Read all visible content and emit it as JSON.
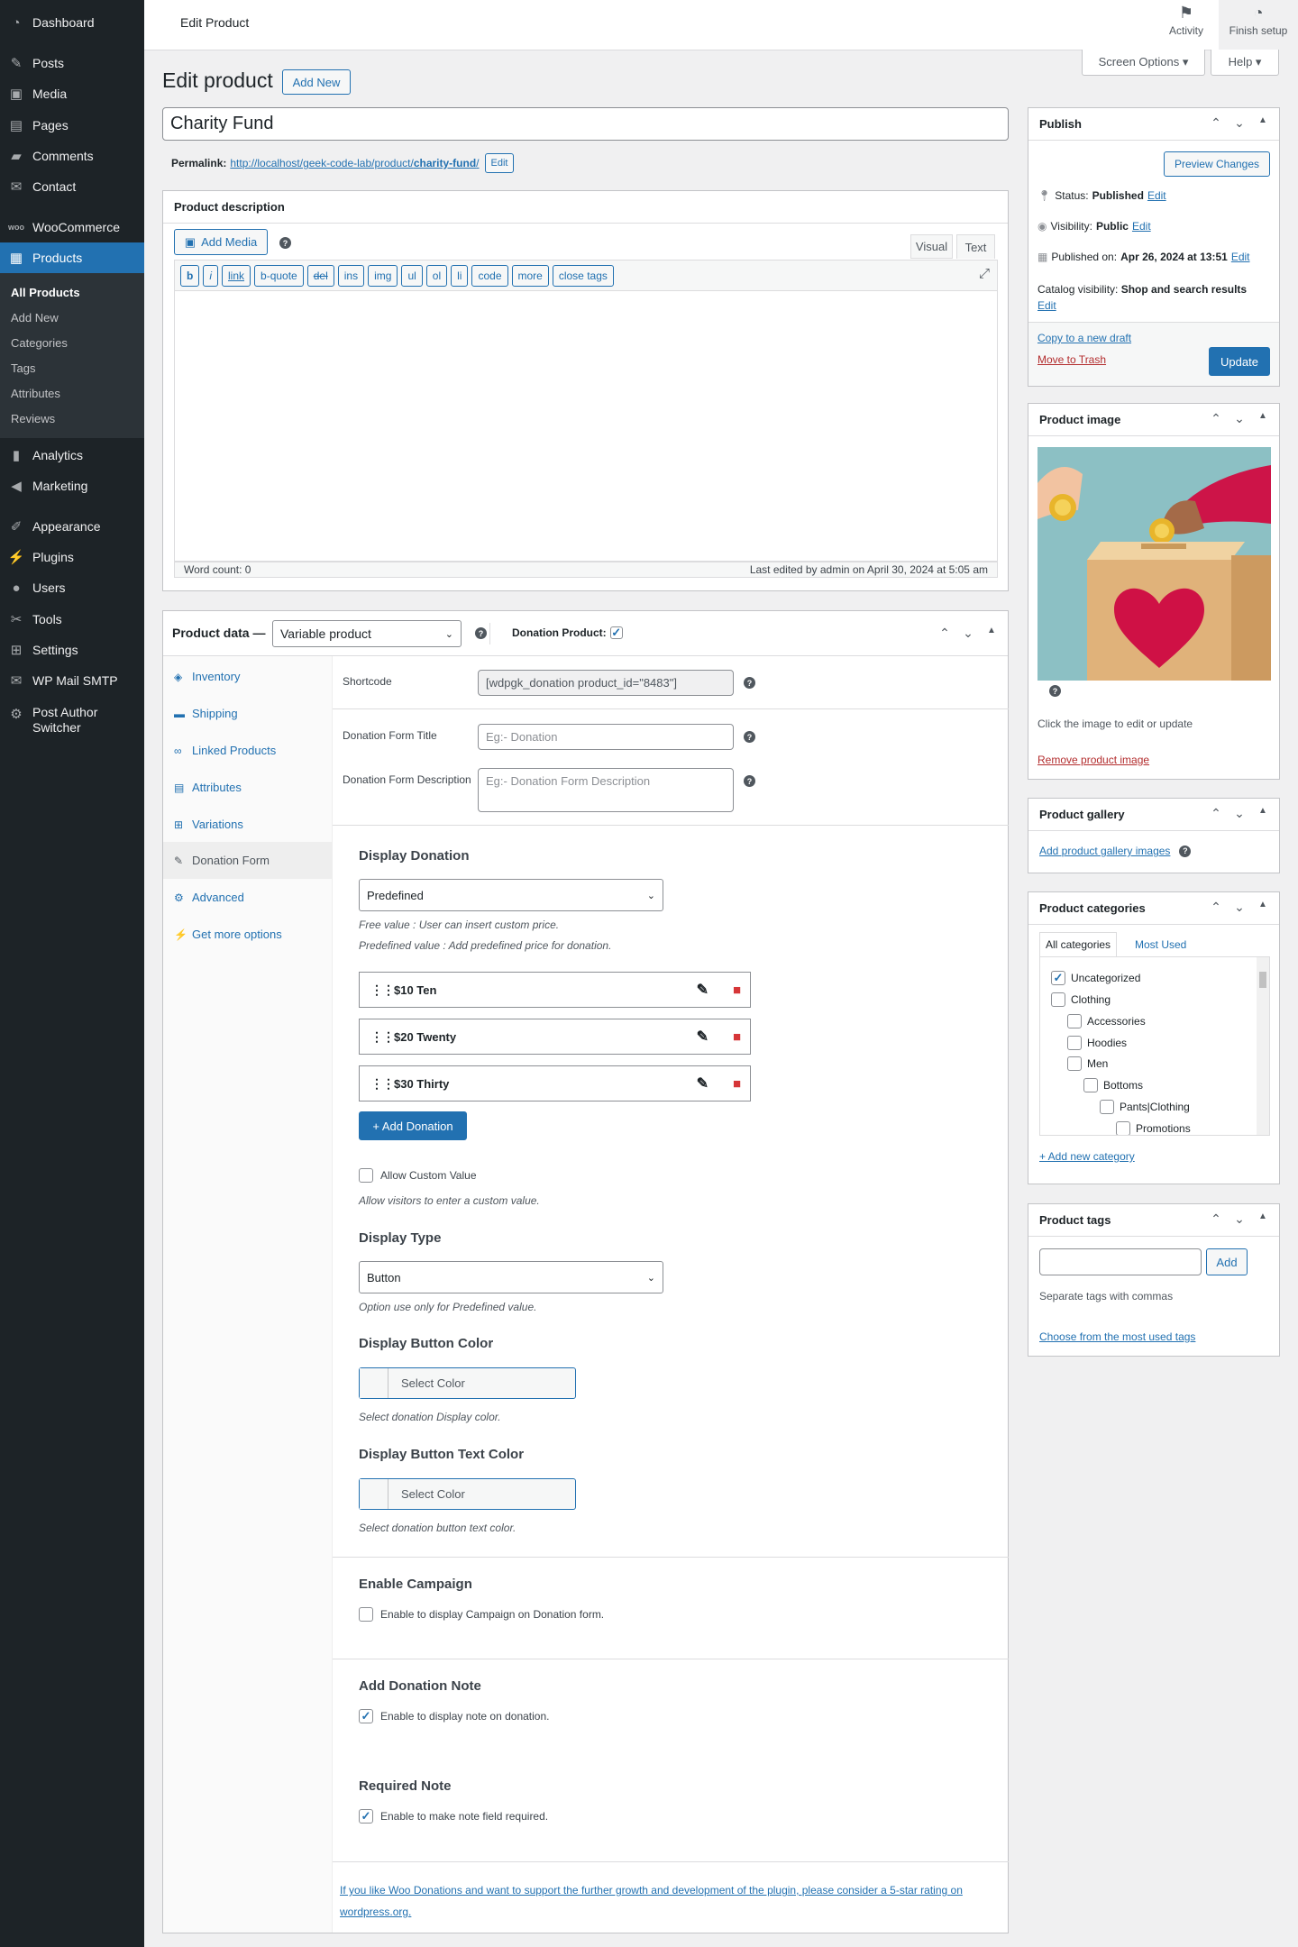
{
  "sidebar": {
    "items": [
      {
        "label": "Dashboard",
        "icon": "dashboard-icon"
      },
      {
        "label": "Posts",
        "icon": "pin-icon"
      },
      {
        "label": "Media",
        "icon": "media-icon"
      },
      {
        "label": "Pages",
        "icon": "page-icon"
      },
      {
        "label": "Comments",
        "icon": "comment-icon"
      },
      {
        "label": "Contact",
        "icon": "mail-icon"
      },
      {
        "label": "WooCommerce",
        "icon": "woo-icon"
      },
      {
        "label": "Products",
        "icon": "products-icon"
      },
      {
        "label": "Analytics",
        "icon": "chart-icon"
      },
      {
        "label": "Marketing",
        "icon": "megaphone-icon"
      },
      {
        "label": "Appearance",
        "icon": "brush-icon"
      },
      {
        "label": "Plugins",
        "icon": "plugin-icon"
      },
      {
        "label": "Users",
        "icon": "user-icon"
      },
      {
        "label": "Tools",
        "icon": "wrench-icon"
      },
      {
        "label": "Settings",
        "icon": "settings-icon"
      },
      {
        "label": "WP Mail SMTP",
        "icon": "mail-icon"
      },
      {
        "label": "Post Author Switcher",
        "icon": "gear-icon"
      }
    ],
    "sub": [
      "All Products",
      "Add New",
      "Categories",
      "Tags",
      "Attributes",
      "Reviews"
    ]
  },
  "topbar": {
    "title": "Edit Product",
    "activity": "Activity",
    "finish": "Finish setup"
  },
  "screen_options": "Screen Options ▾",
  "help": "Help ▾",
  "page": {
    "heading": "Edit product",
    "add_new": "Add New",
    "product_title": "Charity Fund"
  },
  "permalink": {
    "label": "Permalink:",
    "base": "http://localhost/geek-code-lab/product/",
    "slug": "charity-fund",
    "trail": "/",
    "edit": "Edit"
  },
  "description": {
    "title": "Product description",
    "add_media": "Add Media",
    "tab_visual": "Visual",
    "tab_text": "Text",
    "quicktags": [
      "b",
      "i",
      "link",
      "b-quote",
      "del",
      "ins",
      "img",
      "ul",
      "ol",
      "li",
      "code",
      "more",
      "close tags"
    ],
    "word_count": "Word count: 0",
    "last_edited": "Last edited by admin on April 30, 2024 at 5:05 am"
  },
  "product_data": {
    "title": "Product data —",
    "type": "Variable product",
    "donation_label": "Donation Product:",
    "tabs": [
      {
        "label": "Inventory",
        "icon": "tag-icon"
      },
      {
        "label": "Shipping",
        "icon": "truck-icon"
      },
      {
        "label": "Linked Products",
        "icon": "link-icon"
      },
      {
        "label": "Attributes",
        "icon": "list-icon"
      },
      {
        "label": "Variations",
        "icon": "grid-icon"
      },
      {
        "label": "Donation Form",
        "icon": "wrench-icon"
      },
      {
        "label": "Advanced",
        "icon": "gear-icon"
      },
      {
        "label": "Get more options",
        "icon": "plugin-icon"
      }
    ],
    "shortcode_label": "Shortcode",
    "shortcode_value": "[wdpgk_donation product_id=\"8483\"]",
    "form_title_label": "Donation Form Title",
    "form_title_placeholder": "Eg:- Donation",
    "form_desc_label": "Donation Form Description",
    "form_desc_placeholder": "Eg:- Donation Form Description",
    "display_donation": "Display Donation",
    "display_donation_value": "Predefined",
    "hint_free": "Free value : User can insert custom price.",
    "hint_predef": "Predefined value : Add predefined price for donation.",
    "donations": [
      "$10 Ten",
      "$20 Twenty",
      "$30 Thirty"
    ],
    "add_donation": "+ Add Donation",
    "allow_custom": "Allow Custom Value",
    "allow_custom_hint": "Allow visitors to enter a custom value.",
    "display_type": "Display Type",
    "display_type_value": "Button",
    "display_type_hint": "Option use only for Predefined value.",
    "btn_color_title": "Display Button Color",
    "select_color": "Select Color",
    "btn_color_hint": "Select donation Display color.",
    "btn_text_color_title": "Display Button Text Color",
    "btn_text_color_hint": "Select donation button text color.",
    "campaign_title": "Enable Campaign",
    "campaign_label": "Enable to display Campaign on Donation form.",
    "note_title": "Add Donation Note",
    "note_label": "Enable to display note on donation.",
    "required_title": "Required Note",
    "required_label": "Enable to make note field required.",
    "footer_link": "If you like Woo Donations and want to support the further growth and development of the plugin, please consider a 5-star rating on wordpress.org."
  },
  "publish": {
    "title": "Publish",
    "preview": "Preview Changes",
    "status": "Status:",
    "status_value": "Published",
    "visibility": "Visibility:",
    "visibility_value": "Public",
    "published_on": "Published on:",
    "published_value": "Apr 26, 2024 at 13:51",
    "catalog": "Catalog visibility:",
    "catalog_value": "Shop and search results",
    "edit": "Edit",
    "copy_draft": "Copy to a new draft",
    "trash": "Move to Trash",
    "update": "Update"
  },
  "product_image": {
    "title": "Product image",
    "hint": "Click the image to edit or update",
    "remove": "Remove product image"
  },
  "gallery": {
    "title": "Product gallery",
    "add": "Add product gallery images"
  },
  "categories": {
    "title": "Product categories",
    "tab_all": "All categories",
    "tab_used": "Most Used",
    "items": [
      {
        "label": "Uncategorized",
        "checked": true,
        "level": 0
      },
      {
        "label": "Clothing",
        "checked": false,
        "level": 0
      },
      {
        "label": "Accessories",
        "checked": false,
        "level": 1
      },
      {
        "label": "Hoodies",
        "checked": false,
        "level": 1
      },
      {
        "label": "Men",
        "checked": false,
        "level": 1
      },
      {
        "label": "Bottoms",
        "checked": false,
        "level": 2
      },
      {
        "label": "Pants|Clothing",
        "checked": false,
        "level": 3
      },
      {
        "label": "Promotions",
        "checked": false,
        "level": 4
      }
    ],
    "add": "+ Add new category"
  },
  "tags": {
    "title": "Product tags",
    "add": "Add",
    "hint": "Separate tags with commas",
    "choose": "Choose from the most used tags"
  },
  "colors": {
    "accent": "#2271b1",
    "sidebar": "#1d2327",
    "danger": "#d63638"
  }
}
